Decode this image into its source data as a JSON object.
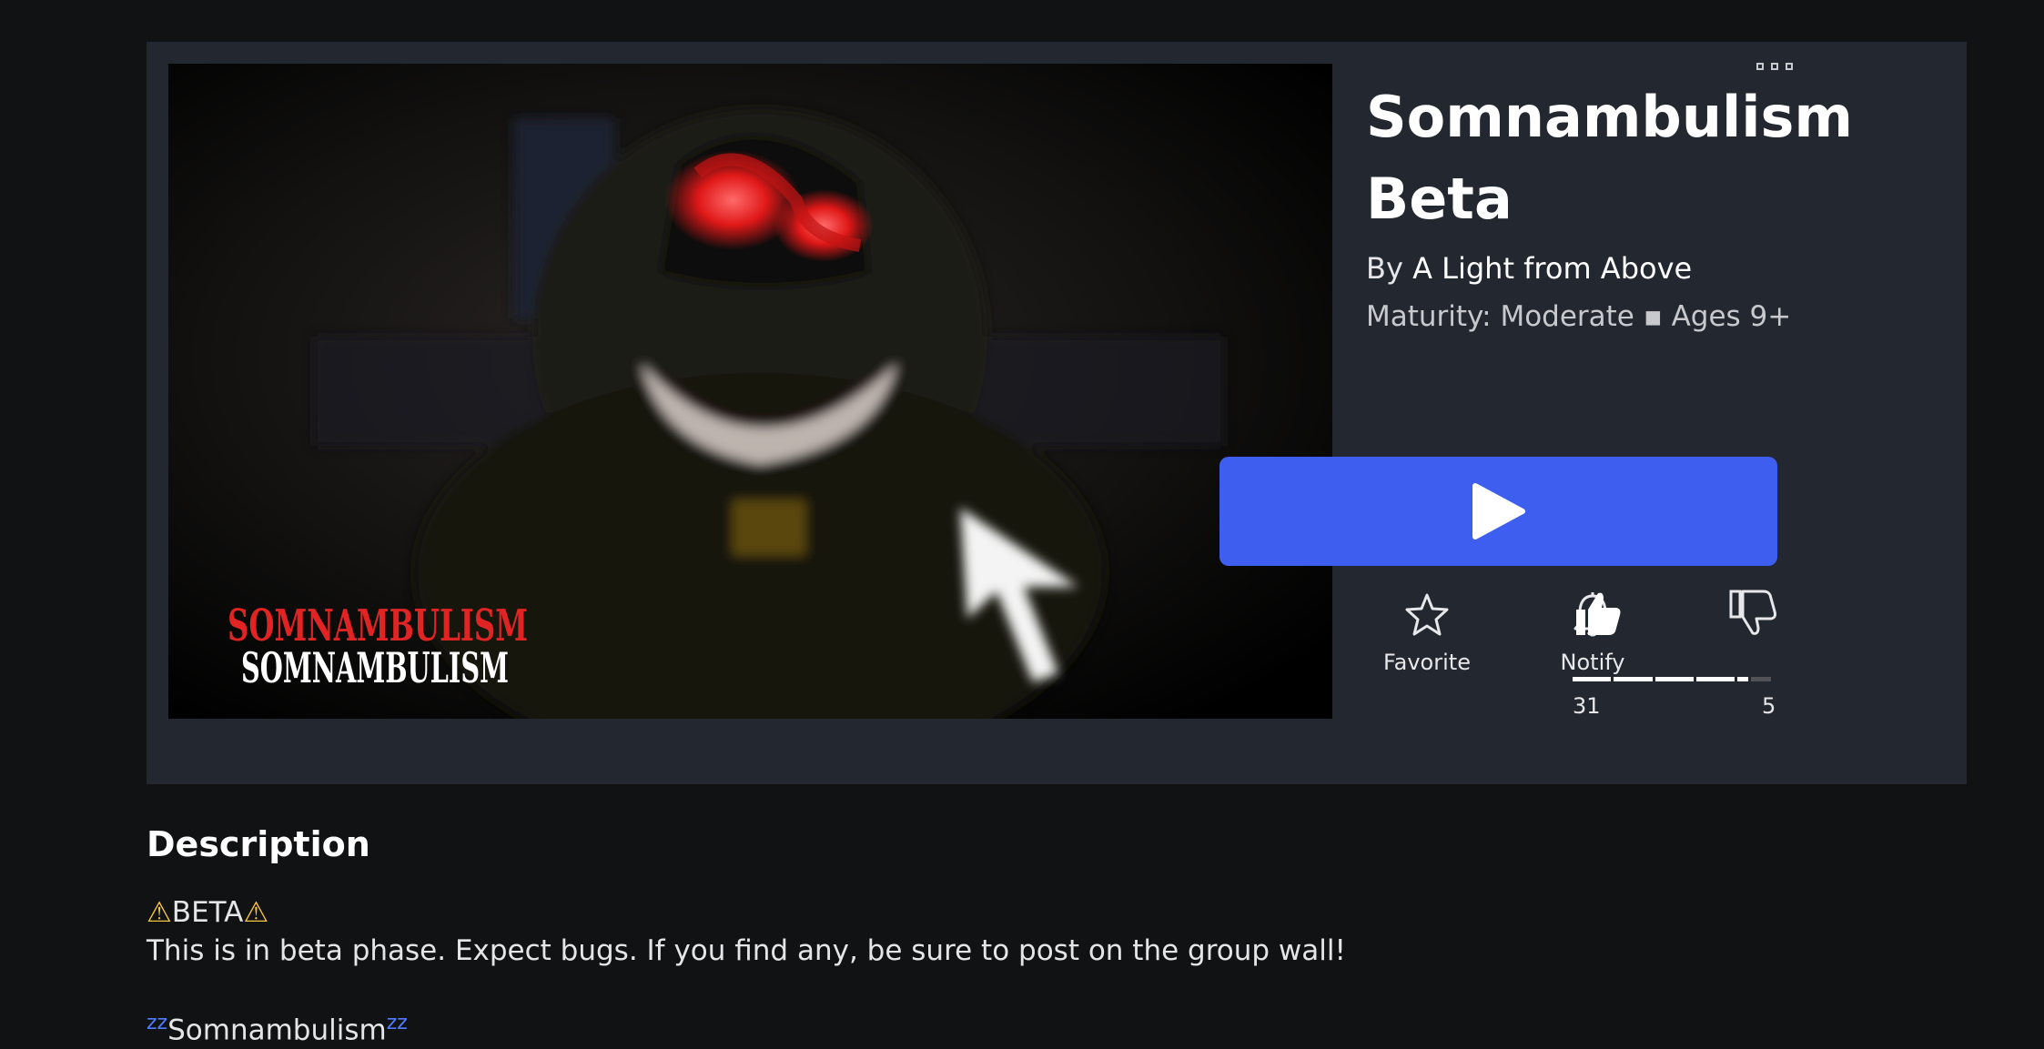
{
  "game": {
    "title": "Somnambulism Beta",
    "creator_prefix": "By",
    "creator_name": "A Light from Above",
    "maturity": "Maturity: Moderate ▪ Ages 9+",
    "thumbnail": {
      "logo_text_red": "SOMNAMBULISM",
      "logo_text_white": "SOMNAMBULISM"
    }
  },
  "actions": {
    "play_icon": "play-icon",
    "favorite_label": "Favorite",
    "notify_label": "Notify",
    "upvotes": "31",
    "downvotes": "5",
    "vote_ratio": 0.86
  },
  "description": {
    "heading": "Description",
    "beta_label": "BETA",
    "beta_text": "This is in beta phase. Expect bugs. If you find any, be sure to post on the group wall!",
    "subtitle": "Somnambulism",
    "subtitle_decor": "zz"
  },
  "colors": {
    "background": "#111214",
    "card": "#232730",
    "play_button": "#3e5ef0",
    "zz_accent": "#4f7cff",
    "warning": "#f5c542"
  }
}
